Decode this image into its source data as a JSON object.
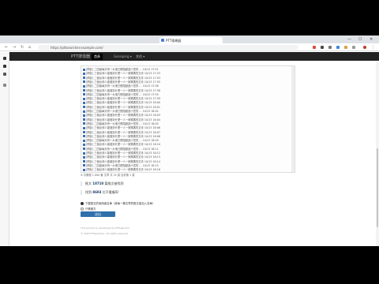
{
  "browser": {
    "tab_title": "PTT搜尋器",
    "url": "https://pttsearcher.example.com/",
    "controls": {
      "minimize": "—",
      "maximize": "☐",
      "close": "✕"
    }
  },
  "site": {
    "brand": "PTT搜尋器",
    "nav": [
      "首頁",
      "Gossiping ▾",
      "其他 ▾"
    ]
  },
  "results": [
    "[問卦] 二四組每天有一大堆已經賠超過十億的 …  10/13 17:51",
    "[問卦] 三個台灣人能做到什麼一人一家媽媽的文青  10/13 17:53",
    "[問卦] 二個台灣人能做到什麼一人一家媽媽的文青  10/13 17:53",
    "[問卦] 三個台灣人能做到什麼一人一家媽媽的文青  10/13 17:55",
    "[問卦] 二四組每天有一大堆已經賠超過十億的 …  10/13 17:58",
    "[問卦] 三個台灣人能做到什麼一人一家媽媽的文青  10/13 17:58",
    "[問卦] 二四組每天有一大堆已經賠超過十億的 …  10/13 17:59",
    "[問卦] 三個台灣人能做到什麼一人一家媽媽的文青  10/13 17:59",
    "[問卦] 二個台灣人能做到什麼一人一家媽媽的文青  10/13 18:00",
    "[問卦] 三個台灣人能做到什麼一人一家媽媽的文青  10/13 18:01",
    "[問卦] 二四組每天有一大堆已經賠超過十億的 …  10/13 18:02",
    "[問卦] 三個台灣人能做到什麼一人一家媽媽的文青  10/13 18:03",
    "[問卦] 三個台灣人能做到什麼一人一家媽媽的文青  10/13 18:04",
    "[問卦] 二四組每天有一大堆已經賠超過十億的 …  10/13 18:05",
    "[問卦] 三個台灣人能做到什麼一人一家媽媽的文青  10/13 18:06",
    "[問卦] 二個台灣人能做到什麼一人一家媽媽的文青  10/13 18:07",
    "[問卦] 三個台灣人能做到什麼一人一家媽媽的文青  10/13 18:08",
    "[問卦] 二四組每天有一大堆已經賠超過十億的 …  10/13 18:09",
    "[問卦] 三個台灣人能做到什麼一人一家媽媽的文青  10/13 18:10",
    "[問卦] 二四組每天有一大堆已經賠超過十億的 …  10/13 18:11",
    "[問卦] 三個台灣人能做到什麼一人一家媽媽的文青  10/13 18:12",
    "[問卦] 二個台灣人能做到什麼一人一家媽媽的文青  10/13 18:13",
    "[問卦] 三個台灣人能做到什麼一人一家媽媽的文青  10/13 18:14",
    "[問卦] 二四組每天有一大堆已經賠超過十億的 …  10/13 18:15",
    "[問卦] 三個台灣人能做到什麼一人一家媽媽的文青  10/13 18:16"
  ],
  "summary": "※ 共篩選 1,000 筆 文章 共 32 頁 目前第 1 頁",
  "highlights": [
    {
      "prefix": "推文 ",
      "value": "18710",
      "suffix": " 篇推文被找到"
    },
    {
      "prefix": "找到 ",
      "value": "8603",
      "suffix": " 位不重複ID"
    }
  ],
  "options": [
    {
      "label": "下載推文的使用者名單（將每一篇文章的推文者加入名單）",
      "checked": true
    },
    {
      "label": "只看噓文",
      "checked": false
    }
  ],
  "submit_label": "送出",
  "footer": [
    "This product is developed by PTTsearcher",
    "© 2020 PTTsearcher, All rights reserved."
  ]
}
